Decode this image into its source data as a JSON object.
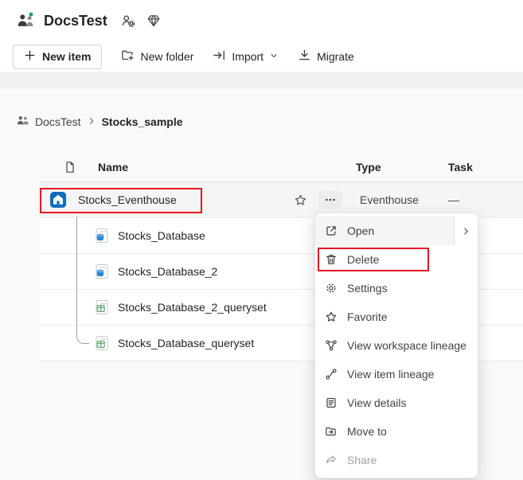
{
  "header": {
    "title": "DocsTest",
    "icons": [
      "workspace-logo",
      "workspace-settings-icon",
      "trial-diamond-icon"
    ]
  },
  "toolbar": {
    "items": [
      {
        "label": "New item",
        "icon": "plus-icon"
      },
      {
        "label": "New folder",
        "icon": "new-folder-icon"
      },
      {
        "label": "Import",
        "icon": "import-icon",
        "has_dropdown": true
      },
      {
        "label": "Migrate",
        "icon": "migrate-icon"
      }
    ]
  },
  "breadcrumb": {
    "items": [
      {
        "label": "DocsTest",
        "icon": "workspace-icon"
      },
      {
        "label": "Stocks_sample"
      }
    ]
  },
  "table": {
    "columns": {
      "name": "Name",
      "type": "Type",
      "task": "Task"
    },
    "rows": [
      {
        "name": "Stocks_Eventhouse",
        "type": "Eventhouse",
        "task": "—",
        "icon": "eventhouse-icon",
        "selected": true,
        "annotated": true
      },
      {
        "name": "Stocks_Database",
        "icon": "kql-database-icon",
        "child": true
      },
      {
        "name": "Stocks_Database_2",
        "icon": "kql-database-icon",
        "child": true
      },
      {
        "name": "Stocks_Database_2_queryset",
        "icon": "kql-queryset-icon",
        "child": true
      },
      {
        "name": "Stocks_Database_queryset",
        "icon": "kql-queryset-icon",
        "child": true
      }
    ]
  },
  "context_menu": {
    "items": [
      {
        "label": "Open",
        "icon": "open-icon",
        "submenu": true
      },
      {
        "label": "Delete",
        "icon": "trash-icon",
        "annotated": true
      },
      {
        "label": "Settings",
        "icon": "gear-icon"
      },
      {
        "label": "Favorite",
        "icon": "star-icon"
      },
      {
        "label": "View workspace lineage",
        "icon": "workspace-lineage-icon"
      },
      {
        "label": "View item lineage",
        "icon": "item-lineage-icon"
      },
      {
        "label": "View details",
        "icon": "view-details-icon"
      },
      {
        "label": "Move to",
        "icon": "move-to-icon"
      },
      {
        "label": "Share",
        "icon": "share-icon",
        "disabled": true
      }
    ]
  },
  "colors": {
    "annotation_red": "#e81123",
    "eventhouse_blue": "#0f6cbd",
    "database_blue": "#2b88d8",
    "queryset_green": "#4f9e63"
  }
}
